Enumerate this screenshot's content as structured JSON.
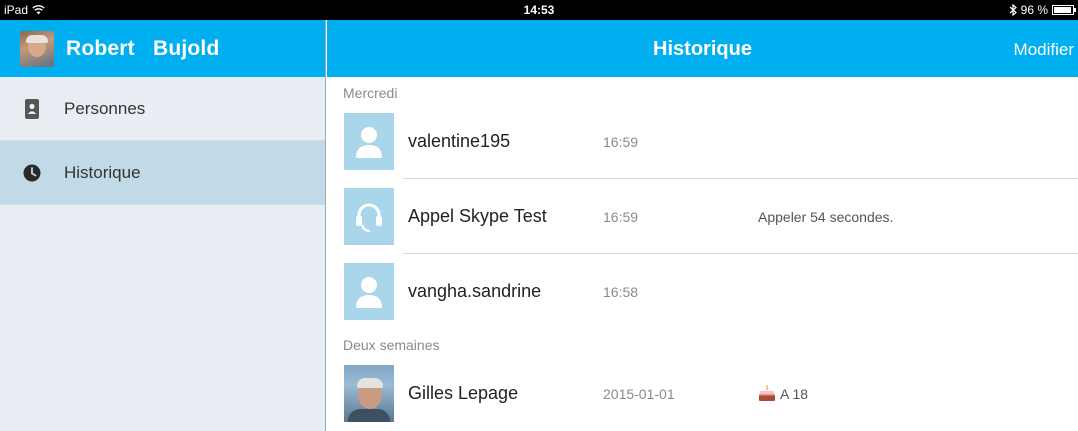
{
  "status_bar": {
    "device": "iPad",
    "time": "14:53",
    "battery": "96 %",
    "battery_level": 0.96
  },
  "sidebar": {
    "user_name": "Robert   Bujold",
    "items": [
      {
        "label": "Personnes",
        "icon": "contacts-icon",
        "active": false
      },
      {
        "label": "Historique",
        "icon": "clock-icon",
        "active": true
      }
    ]
  },
  "main": {
    "title": "Historique",
    "edit_label": "Modifier",
    "sections": [
      {
        "label": "Mercredi",
        "rows": [
          {
            "name": "valentine195",
            "time": "16:59",
            "detail": "",
            "avatar": "default-person"
          },
          {
            "name": "Appel Skype Test",
            "time": "16:59",
            "detail": "Appeler 54 secondes.",
            "avatar": "headset"
          },
          {
            "name": "vangha.sandrine",
            "time": "16:58",
            "detail": "",
            "avatar": "default-person"
          }
        ]
      },
      {
        "label": "Deux semaines",
        "rows": [
          {
            "name": "Gilles Lepage",
            "time": "2015-01-01",
            "detail": "A 18",
            "avatar": "photo",
            "badge_icon": "birthday-cake-icon"
          }
        ]
      }
    ]
  },
  "colors": {
    "accent": "#00aff0",
    "sidebar_bg": "#e8eef3",
    "sidebar_active": "#c0dbe7",
    "avatar_placeholder": "#a9d6ea"
  }
}
